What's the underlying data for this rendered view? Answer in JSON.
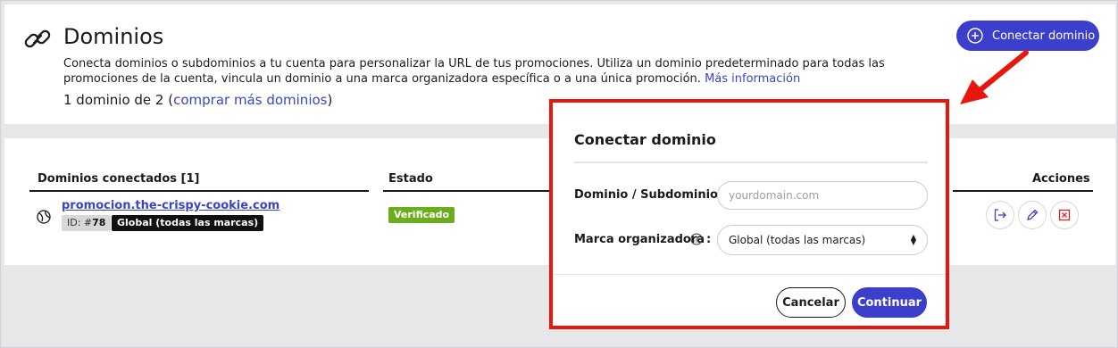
{
  "header": {
    "title": "Dominios",
    "description": "Conecta dominios o subdominios a tu cuenta para personalizar la URL de tus promociones. Utiliza un dominio predeterminado para todas las promociones de la cuenta, vincula un dominio a una marca organizadora específica o a una única promoción.",
    "more_info_link": "Más información",
    "count_prefix": "1 dominio de 2 (",
    "count_link": "comprar más dominios",
    "count_suffix": ")",
    "connect_button": "Conectar dominio"
  },
  "table": {
    "columns": {
      "domains": "Dominios conectados [1]",
      "status": "Estado",
      "actions": "Acciones"
    },
    "rows": [
      {
        "domain": "promocion.the-crispy-cookie.com",
        "id_label": "ID: #",
        "id_value": "78",
        "brand": "Global (todas las marcas)",
        "status": "Verificado"
      }
    ]
  },
  "modal": {
    "title": "Conectar dominio",
    "domain_label": "Dominio / Subdominio:",
    "domain_placeholder": "yourdomain.com",
    "domain_value": "",
    "brand_label": "Marca organizadora",
    "brand_colon": ":",
    "brand_selected": "Global (todas las marcas)",
    "cancel": "Cancelar",
    "continue": "Continuar"
  },
  "colors": {
    "accent": "#3b3fcc",
    "link": "#3a45c4",
    "verified": "#6cad1f",
    "highlight": "#e8160c",
    "delete": "#d8262a"
  },
  "icons": {
    "title": "link-icon",
    "connect": "plus-circle-icon",
    "row": "globe-icon",
    "actions": [
      "sign-out-icon",
      "pencil-icon",
      "close-box-icon"
    ],
    "help": "question-circle-icon"
  }
}
